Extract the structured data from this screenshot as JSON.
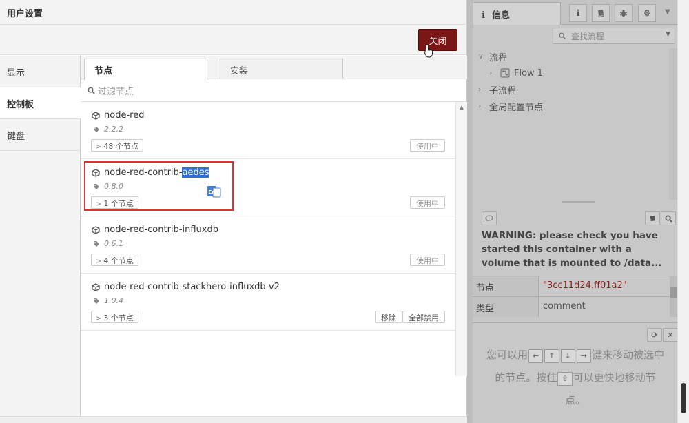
{
  "dialog": {
    "title": "用户设置",
    "close_label": "关闭",
    "nav": [
      "显示",
      "控制板",
      "键盘"
    ],
    "tabs": [
      "节点",
      "安装"
    ],
    "filter_placeholder": "过滤节点",
    "nodes": [
      {
        "name_prefix": "node-red",
        "name_highlight": "",
        "version": "2.2.2",
        "count": "48 个节点",
        "buttons": [
          "使用中"
        ]
      },
      {
        "name_prefix": "node-red-contrib-",
        "name_highlight": "aedes",
        "version": "0.8.0",
        "count": "1 个节点",
        "buttons": [
          "使用中"
        ]
      },
      {
        "name_prefix": "node-red-contrib-influxdb",
        "name_highlight": "",
        "version": "0.6.1",
        "count": "4 个节点",
        "buttons": [
          "使用中"
        ]
      },
      {
        "name_prefix": "node-red-contrib-stackhero-influxdb-v2",
        "name_highlight": "",
        "version": "1.0.4",
        "count": "3 个节点",
        "buttons": [
          "移除",
          "全部禁用"
        ]
      }
    ],
    "ime_label": "En"
  },
  "sidebar": {
    "info_tab": "信息",
    "search_placeholder": "查找流程",
    "tree": {
      "flows": "流程",
      "flow_item": "Flow 1",
      "subflows": "子流程",
      "global_config": "全局配置节点"
    },
    "warning": "WARNING: please check you have started this container with a volume that is mounted to /data...",
    "props": [
      {
        "key": "节点",
        "value": "\"3cc11d24.ff01a2\""
      },
      {
        "key": "类型",
        "value": "comment"
      }
    ],
    "help": {
      "part1": "您可以用",
      "keys_arrows": [
        "←",
        "↑",
        "↓",
        "→"
      ],
      "part2": "键来移动被选中的节点。按住",
      "key_shift": "⇧",
      "part3": "可以更快地移动节点。"
    }
  }
}
